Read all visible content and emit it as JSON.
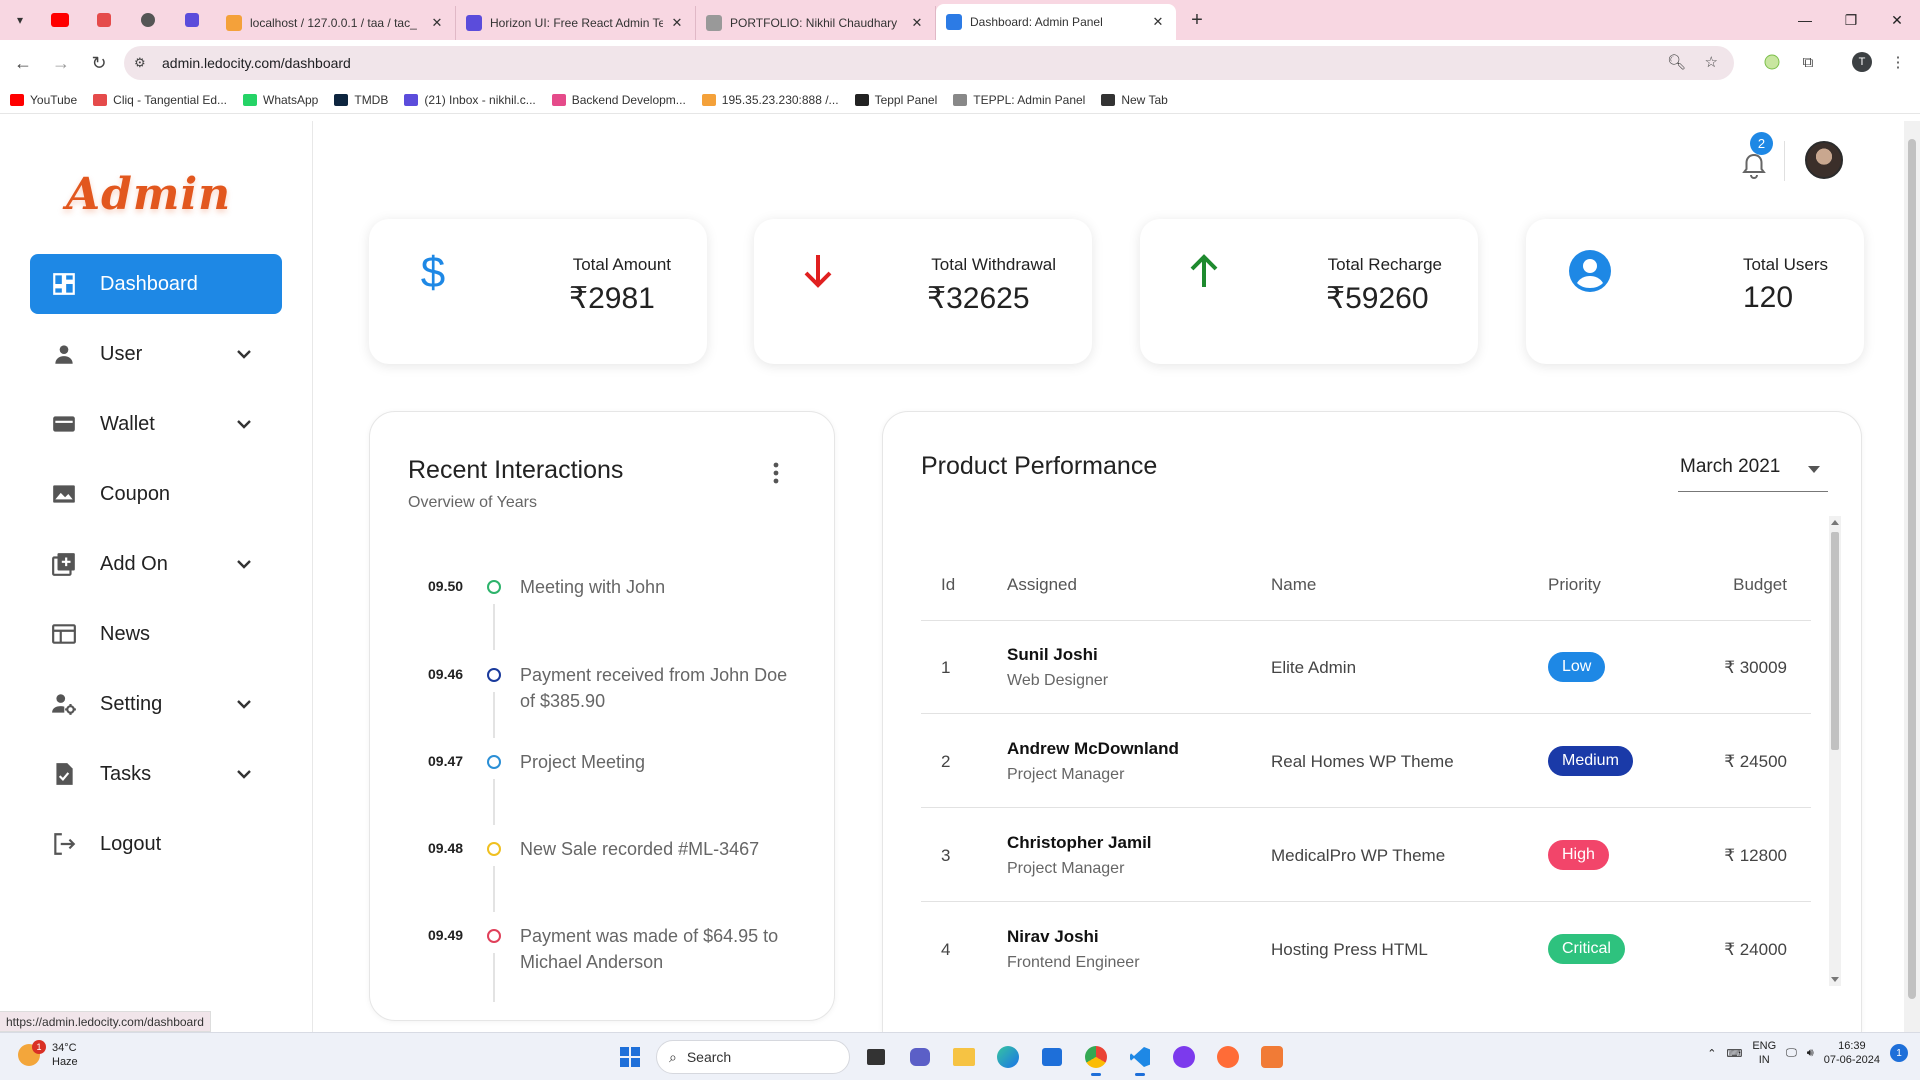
{
  "browser": {
    "tabs": [
      {
        "title": "localhost / 127.0.0.1 / taa / tac_",
        "color": "#f4a13a"
      },
      {
        "title": "Horizon UI: Free React Admin Te",
        "color": "#5b4cdb"
      },
      {
        "title": "PORTFOLIO: Nikhil Chaudhary",
        "color": "#777777"
      },
      {
        "title": "Dashboard: Admin Panel",
        "color": "#2c7be5",
        "active": true
      }
    ],
    "url": "admin.ledocity.com/dashboard",
    "status_url": "https://admin.ledocity.com/dashboard",
    "profile_initial": "T",
    "bookmarks": [
      {
        "label": "YouTube",
        "color": "#ff0000"
      },
      {
        "label": "Cliq - Tangential Ed...",
        "color": "#e54b4b"
      },
      {
        "label": "WhatsApp",
        "color": "#25d366"
      },
      {
        "label": "TMDB",
        "color": "#0d253f"
      },
      {
        "label": "(21) Inbox - nikhil.c...",
        "color": "#5b4cdb"
      },
      {
        "label": "Backend Developm...",
        "color": "#e54b8a"
      },
      {
        "label": "195.35.23.230:888 /...",
        "color": "#f4a13a"
      },
      {
        "label": "Teppl Panel",
        "color": "#222222"
      },
      {
        "label": "TEPPL: Admin Panel",
        "color": "#888888"
      },
      {
        "label": "New Tab",
        "color": "#333333"
      }
    ]
  },
  "sidebar": {
    "logo": "Admin",
    "items": [
      {
        "label": "Dashboard",
        "icon": "dashboard-icon",
        "active": true,
        "expandable": false
      },
      {
        "label": "User",
        "icon": "user-icon",
        "expandable": true
      },
      {
        "label": "Wallet",
        "icon": "wallet-icon",
        "expandable": true
      },
      {
        "label": "Coupon",
        "icon": "image-icon",
        "expandable": false
      },
      {
        "label": "Add On",
        "icon": "library-add-icon",
        "expandable": true
      },
      {
        "label": "News",
        "icon": "news-icon",
        "expandable": false
      },
      {
        "label": "Setting",
        "icon": "manage-accounts-icon",
        "expandable": true
      },
      {
        "label": "Tasks",
        "icon": "task-icon",
        "expandable": true
      },
      {
        "label": "Logout",
        "icon": "logout-icon",
        "expandable": false
      }
    ]
  },
  "header": {
    "notification_count": "2"
  },
  "stats": [
    {
      "label": "Total Amount",
      "value": "₹2981",
      "icon": "dollar-icon",
      "color": "#1e88e5"
    },
    {
      "label": "Total Withdrawal",
      "value": "₹32625",
      "icon": "arrow-down-icon",
      "color": "#e02020"
    },
    {
      "label": "Total Recharge",
      "value": "₹59260",
      "icon": "arrow-up-icon",
      "color": "#1e8a2e"
    },
    {
      "label": "Total Users",
      "value": "120",
      "icon": "account-circle-icon",
      "color": "#1e88e5"
    }
  ],
  "recent_interactions": {
    "title": "Recent Interactions",
    "subtitle": "Overview of Years",
    "items": [
      {
        "time": "09.50",
        "text": "Meeting with John",
        "color": "#2db36b"
      },
      {
        "time": "09.46",
        "text": "Payment received from John Doe of $385.90",
        "color": "#1a3a9c"
      },
      {
        "time": "09.47",
        "text": "Project Meeting",
        "color": "#2b8fd6"
      },
      {
        "time": "09.48",
        "text": "New Sale recorded #ML-3467",
        "color": "#f0c020"
      },
      {
        "time": "09.49",
        "text": "Payment was made of $64.95 to Michael Anderson",
        "color": "#e0405a"
      }
    ]
  },
  "product_performance": {
    "title": "Product Performance",
    "month": "March 2021",
    "columns": [
      "Id",
      "Assigned",
      "Name",
      "Priority",
      "Budget"
    ],
    "rows": [
      {
        "id": "1",
        "assigned": "Sunil Joshi",
        "role": "Web Designer",
        "name": "Elite Admin",
        "priority": "Low",
        "priority_color": "#1e88e5",
        "budget": "₹ 30009"
      },
      {
        "id": "2",
        "assigned": "Andrew McDownland",
        "role": "Project Manager",
        "name": "Real Homes WP Theme",
        "priority": "Medium",
        "priority_color": "#1a3aa8",
        "budget": "₹ 24500"
      },
      {
        "id": "3",
        "assigned": "Christopher Jamil",
        "role": "Project Manager",
        "name": "MedicalPro WP Theme",
        "priority": "High",
        "priority_color": "#f2456a",
        "budget": "₹ 12800"
      },
      {
        "id": "4",
        "assigned": "Nirav Joshi",
        "role": "Frontend Engineer",
        "name": "Hosting Press HTML",
        "priority": "Critical",
        "priority_color": "#2ec27e",
        "budget": "₹ 24000"
      }
    ]
  },
  "taskbar": {
    "weather_temp": "34°C",
    "weather_desc": "Haze",
    "weather_badge": "1",
    "search_placeholder": "Search",
    "lang_top": "ENG",
    "lang_bottom": "IN",
    "time": "16:39",
    "date": "07-06-2024",
    "notification_count": "1"
  }
}
